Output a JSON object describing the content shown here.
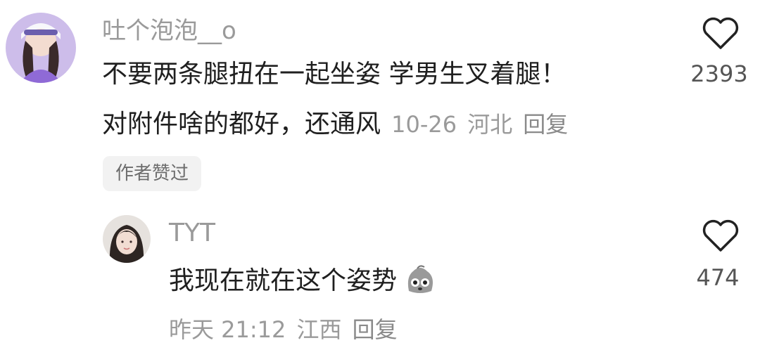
{
  "comment": {
    "username": "吐个泡泡__o",
    "line1": "不要两条腿扭在一起坐姿   学男生叉着腿！",
    "line2": "对附件啥的都好，还通风",
    "date": "10-26",
    "location": "河北",
    "reply_label": "回复",
    "like_count": "2393",
    "badge": "作者赞过"
  },
  "reply": {
    "username": "TYT",
    "text": "我现在就在这个姿势",
    "time": "昨天 21:12",
    "location": "江西",
    "reply_label": "回复",
    "like_count": "474"
  },
  "colors": {
    "meta_gray": "#9a9a9a",
    "badge_bg": "#f2f2f2",
    "avatar1_bg": "#c9b9e8",
    "avatar2_bg": "#e3e0dd"
  },
  "icons": [
    "heart-outline-icon",
    "emoji-face-icon"
  ]
}
